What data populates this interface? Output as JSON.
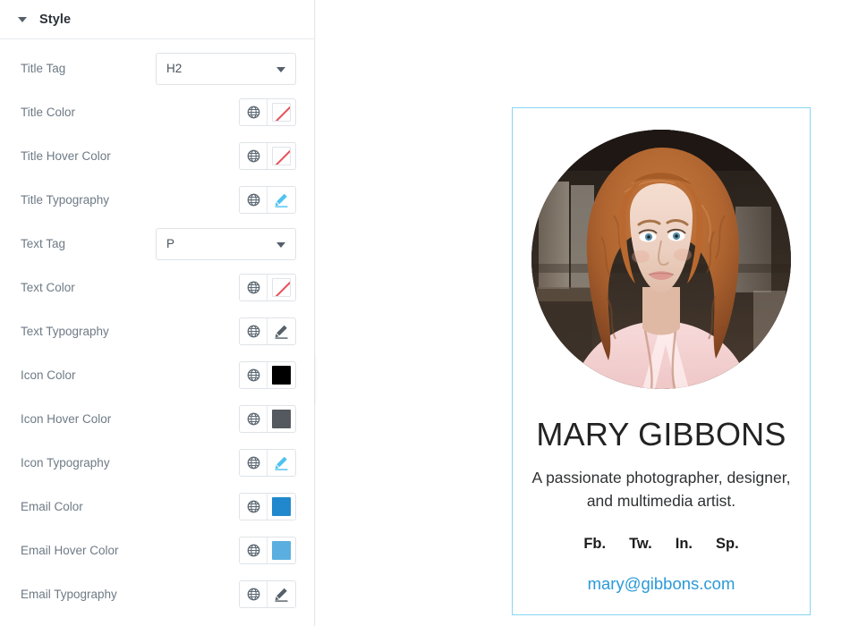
{
  "panel": {
    "header": {
      "title": "Style",
      "caret_icon": "chevron-down-icon"
    },
    "rows": [
      {
        "label": "Title Tag",
        "control": "select",
        "value": "H2",
        "globe_icon": "globe-icon",
        "arrow_icon": "chevron-down-icon"
      },
      {
        "label": "Title Color",
        "control": "color-empty",
        "value": "",
        "globe_icon": "globe-icon",
        "slash_color": "#e8505b"
      },
      {
        "label": "Title Hover Color",
        "control": "color-empty",
        "value": "",
        "globe_icon": "globe-icon",
        "slash_color": "#e8505b"
      },
      {
        "label": "Title Typography",
        "control": "typography",
        "value": "",
        "globe_icon": "globe-icon",
        "pencil_icon": "pencil-edit-icon",
        "pencil_color": "#4ec3f0"
      },
      {
        "label": "Text Tag",
        "control": "select",
        "value": "P",
        "globe_icon": "globe-icon",
        "arrow_icon": "chevron-down-icon"
      },
      {
        "label": "Text Color",
        "control": "color-empty",
        "value": "",
        "globe_icon": "globe-icon",
        "slash_color": "#e8505b"
      },
      {
        "label": "Text Typography",
        "control": "typography",
        "value": "",
        "globe_icon": "globe-icon",
        "pencil_icon": "pencil-edit-icon",
        "pencil_color": "#55606b"
      },
      {
        "label": "Icon Color",
        "control": "color",
        "value": "#000000",
        "globe_icon": "globe-icon"
      },
      {
        "label": "Icon Hover Color",
        "control": "color",
        "value": "#54595f",
        "globe_icon": "globe-icon"
      },
      {
        "label": "Icon Typography",
        "control": "typography",
        "value": "",
        "globe_icon": "globe-icon",
        "pencil_icon": "pencil-edit-icon",
        "pencil_color": "#4ec3f0"
      },
      {
        "label": "Email Color",
        "control": "color",
        "value": "#2188cd",
        "globe_icon": "globe-icon"
      },
      {
        "label": "Email Hover Color",
        "control": "color",
        "value": "#5aafe0",
        "globe_icon": "globe-icon"
      },
      {
        "label": "Email Typography",
        "control": "typography",
        "value": "",
        "globe_icon": "globe-icon",
        "pencil_icon": "pencil-edit-icon",
        "pencil_color": "#55606b"
      }
    ]
  },
  "collapse_handle": {
    "icon": "chevron-left-icon"
  },
  "card": {
    "border_color": "#86d6f5",
    "avatar": {
      "alt": "portrait-photo-woman-curly-auburn-hair"
    },
    "title": "MARY GIBBONS",
    "description": "A passionate photographer, designer, and multimedia artist.",
    "social": [
      "Fb.",
      "Tw.",
      "In.",
      "Sp."
    ],
    "email": "mary@gibbons.com",
    "email_color": "#2a9ad8"
  }
}
